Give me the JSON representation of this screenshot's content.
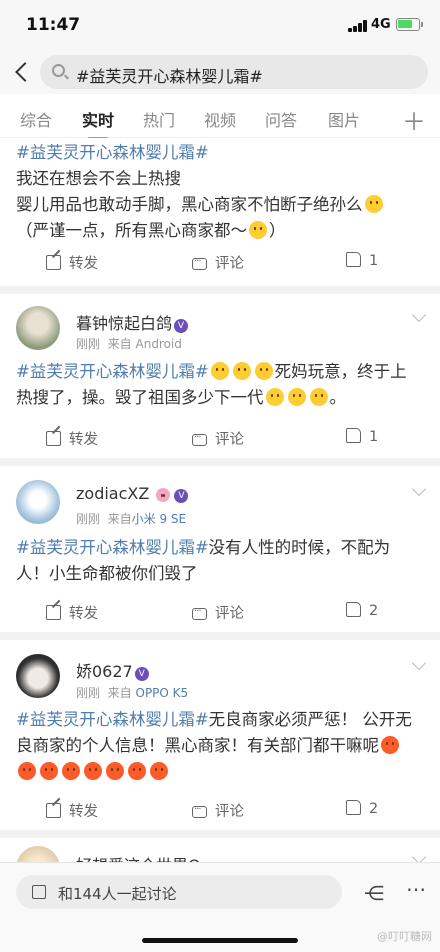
{
  "status": {
    "time": "11:47",
    "network": "4G"
  },
  "search": {
    "query": "#益芙灵开心森林婴儿霜#"
  },
  "tabs": [
    "综合",
    "实时",
    "热门",
    "视频",
    "问答",
    "图片"
  ],
  "posts": [
    {
      "hashtag": "#益芙灵开心森林婴儿霜#",
      "lines": [
        "我还在想会不会上热搜",
        "婴儿用品也敢动手脚，黑心商家不怕断子绝孙么",
        "（严谨一点，所有黑心商家都～"
      ],
      "repost": "转发",
      "comment": "评论",
      "likes": "1"
    },
    {
      "user": "暮钟惊起白鸽",
      "vip": "V",
      "time": "刚刚",
      "source_prefix": "来自",
      "source": "Android",
      "hashtag": "#益芙灵开心森林婴儿霜#",
      "text_a": "死妈玩意，终于上",
      "text_b": "热搜了，操。毁了祖国多少下一代",
      "repost": "转发",
      "comment": "评论",
      "likes": "1"
    },
    {
      "user": "zodiacXZ",
      "vip": "V",
      "time": "刚刚",
      "source_prefix": "来自",
      "source": "小米 9 SE",
      "hashtag": "#益芙灵开心森林婴儿霜#",
      "text_a": "没有人性的时候，不配为",
      "text_b": "人！小生命都被你们毁了",
      "repost": "转发",
      "comment": "评论",
      "likes": "2"
    },
    {
      "user": "娇0627",
      "vip": "V",
      "time": "刚刚",
      "source_prefix": "来自",
      "source": "OPPO K5",
      "hashtag": "#益芙灵开心森林婴儿霜#",
      "text_a": "无良商家必须严惩！ 公开无",
      "text_b": "良商家的个人信息！黑心商家！有关部门都干嘛呢",
      "repost": "转发",
      "comment": "评论",
      "likes": "2"
    },
    {
      "user": "好想爱这个世界O"
    }
  ],
  "bottom": {
    "discuss_label": "和144人一起讨论",
    "share_icon": "share-icon",
    "more_icon": "more-icon"
  },
  "watermark": "@叮叮糖网"
}
